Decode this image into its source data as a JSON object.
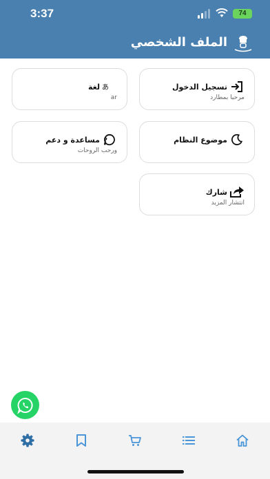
{
  "status_bar": {
    "time": "3:37",
    "battery": "74"
  },
  "header": {
    "title": "الملف الشخصي",
    "logo": "robot-chef-logo-icon",
    "bg_color": "#4a80b0"
  },
  "cards": [
    {
      "title": "تسجيل الدخول",
      "subtitle": "مرحبا بمطارد",
      "icon": "login-icon"
    },
    {
      "title": "لغة",
      "subtitle": "ar",
      "icon": "translate-icon"
    },
    {
      "title": "موضوع النظام",
      "subtitle": "",
      "icon": "moon-icon"
    },
    {
      "title": "مساعدة و دعم",
      "subtitle": "ورحب الروحات",
      "icon": "help-icon"
    },
    {
      "title": "شارك",
      "subtitle": "انتشار المزيد",
      "icon": "share-icon"
    }
  ],
  "whatsapp": {
    "icon": "whatsapp-icon",
    "color": "#25d366"
  },
  "bottom_nav": [
    {
      "name": "settings",
      "icon": "gear-icon",
      "active": true
    },
    {
      "name": "bookmarks",
      "icon": "bookmark-icon",
      "active": false
    },
    {
      "name": "cart",
      "icon": "cart-icon",
      "active": false
    },
    {
      "name": "list",
      "icon": "list-icon",
      "active": false
    },
    {
      "name": "home",
      "icon": "home-icon",
      "active": false
    }
  ],
  "colors": {
    "active_nav": "#2f6fa6",
    "inactive_nav": "#4a94d8"
  }
}
